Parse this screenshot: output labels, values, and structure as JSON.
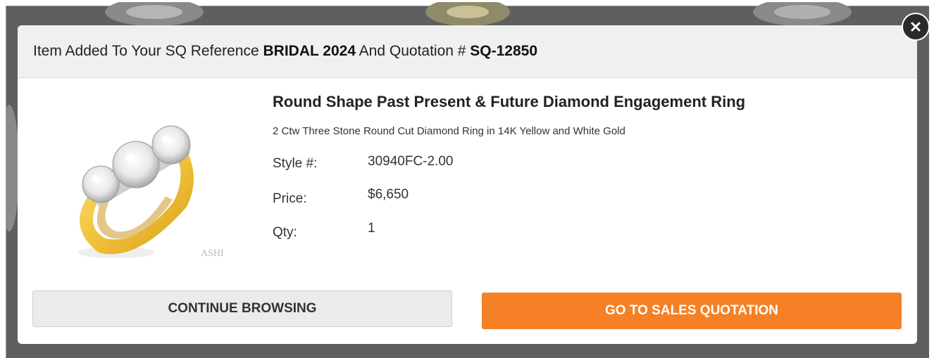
{
  "header": {
    "prefix": "Item Added To Your SQ Reference ",
    "reference": "BRIDAL 2024",
    "middle": " And Quotation # ",
    "quotation_number": "SQ-12850"
  },
  "product": {
    "title": "Round Shape Past Present & Future Diamond Engagement Ring",
    "description": "2 Ctw Three Stone Round Cut Diamond Ring in 14K Yellow and White Gold",
    "image_watermark": "ASHI",
    "specs": [
      {
        "label": "Style #:",
        "value": "30940FC-2.00"
      },
      {
        "label": "Price:",
        "value": "$6,650"
      },
      {
        "label": "Qty:",
        "value": "1"
      }
    ]
  },
  "buttons": {
    "continue_label": "CONTINUE BROWSING",
    "quotation_label": "GO TO SALES QUOTATION"
  },
  "icons": {
    "close": "close-icon",
    "product_image": "ring-image"
  },
  "colors": {
    "accent": "#f58025",
    "backdrop": "#5f5f5f",
    "header_bg": "#f0f0f0",
    "secondary_button": "#ebebeb"
  }
}
